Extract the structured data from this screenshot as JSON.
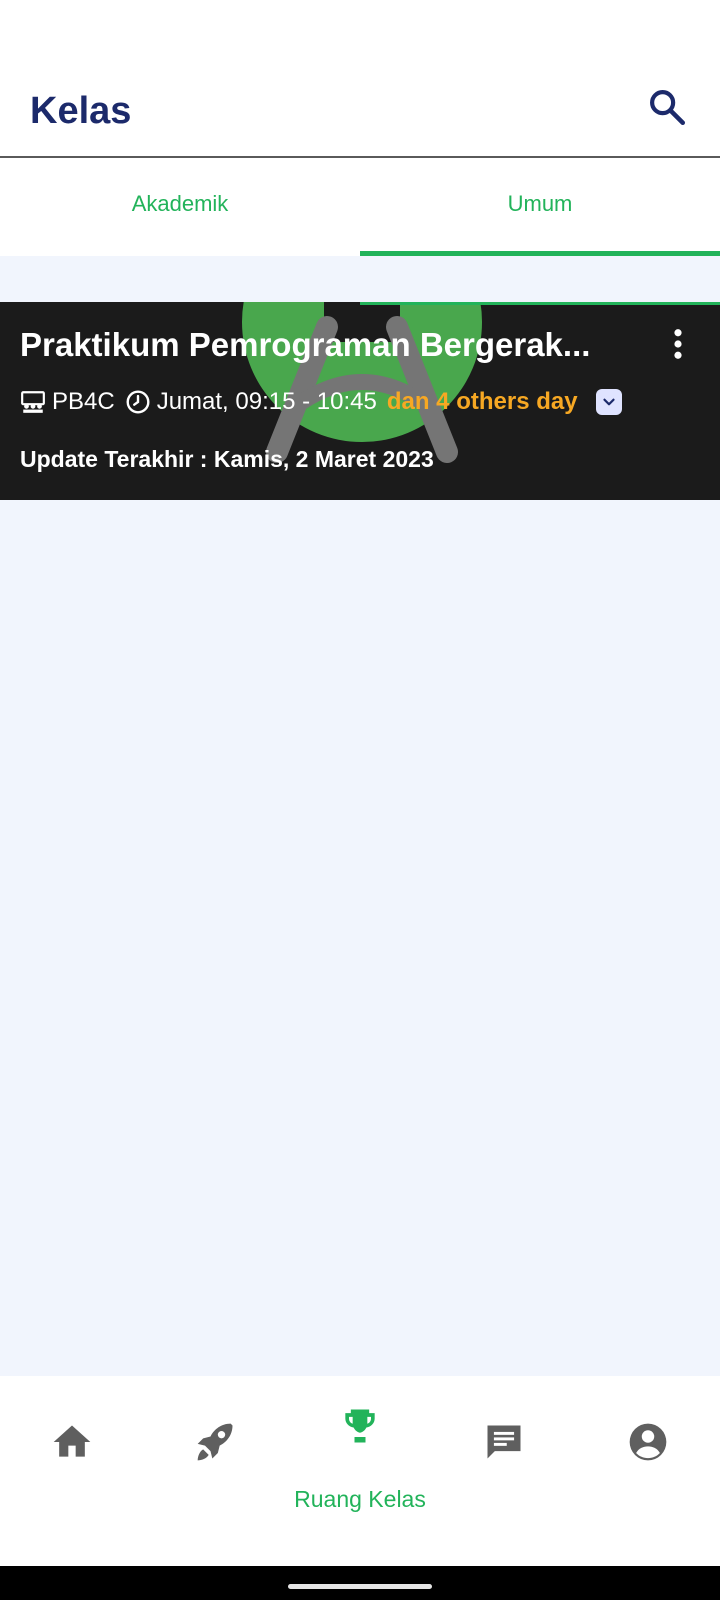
{
  "app_bar": {
    "title": "Kelas"
  },
  "tabs": [
    {
      "label": "Akademik",
      "active": false
    },
    {
      "label": "Umum",
      "active": true
    }
  ],
  "class_card": {
    "title": "Praktikum Pemrograman Bergerak...",
    "class_code": "PB4C",
    "schedule": "Jumat, 09:15 - 10:45",
    "others": "dan 4 others day",
    "updated": "Update Terakhir : Kamis, 2 Maret 2023"
  },
  "bottom_nav": {
    "items": [
      {
        "icon": "home-icon",
        "label": ""
      },
      {
        "icon": "rocket-icon",
        "label": ""
      },
      {
        "icon": "trophy-icon",
        "label": "Ruang Kelas",
        "active": true
      },
      {
        "icon": "chat-icon",
        "label": ""
      },
      {
        "icon": "account-icon",
        "label": ""
      }
    ]
  },
  "colors": {
    "primary_green": "#22b35a",
    "title_navy": "#1c2a6b",
    "others_orange": "#f7a823",
    "content_bg": "#f1f5fd",
    "icon_gray": "#5f5f5f"
  }
}
